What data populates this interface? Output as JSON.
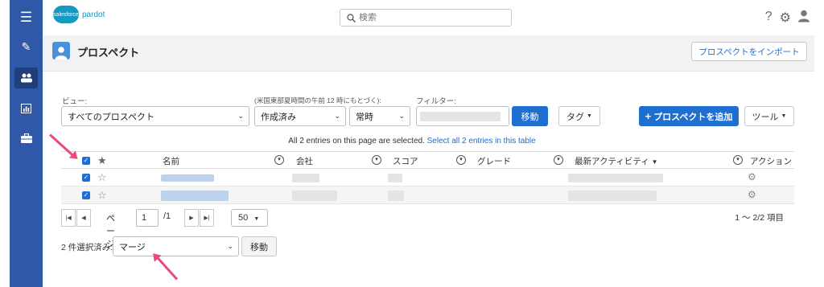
{
  "brand": {
    "cloud_text": "salesforce",
    "product": "pardot"
  },
  "search": {
    "placeholder": "検索"
  },
  "header": {
    "title": "プロスペクト",
    "import_button": "プロスペクトをインポート"
  },
  "filters": {
    "view_label": "ビュー:",
    "view_value": "すべてのプロスペクト",
    "time_label": "(米国東部夏時間の午前 12 時にもとづく):",
    "date_field_value": "作成済み",
    "period_value": "常時",
    "filter_label": "フィルター:",
    "move_button": "移動",
    "tag_button": "タグ",
    "add_button": "プロスペクトを追加",
    "tools_button": "ツール"
  },
  "notice": {
    "text": "All 2 entries on this page are selected.",
    "link": "Select all 2 entries in this table"
  },
  "table": {
    "columns": [
      "名前",
      "会社",
      "スコア",
      "グレード",
      "最新アクティビティ",
      "アクション"
    ],
    "sort_indicator": "▼",
    "rows": [
      {
        "selected": true
      },
      {
        "selected": true
      }
    ]
  },
  "pager": {
    "page_label": "ページ",
    "page_value": "1",
    "total_pages": "/1",
    "per_page": "50",
    "range_text": "1 〜 2/2 項目"
  },
  "bulk": {
    "label": "2 件選択済み:",
    "action_value": "マージ",
    "move_button": "移動"
  },
  "colors": {
    "sidebar": "#2f59a8",
    "accent": "#1e6fd0",
    "arrow": "#e94b7a"
  }
}
